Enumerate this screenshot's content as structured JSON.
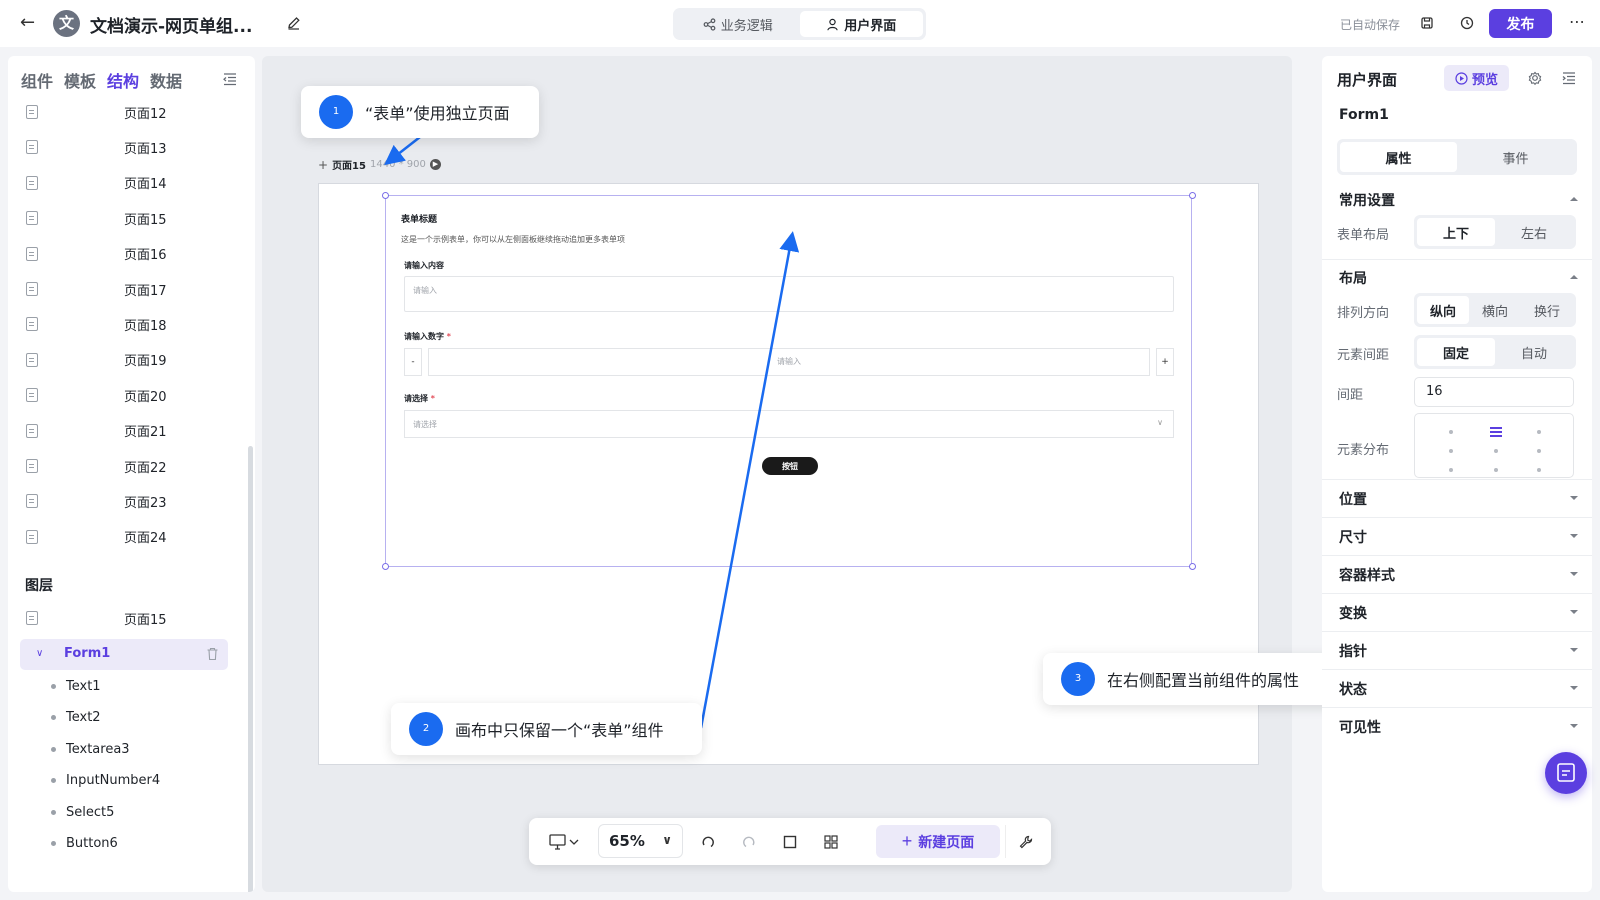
{
  "header": {
    "app_avatar": "文",
    "title": "文档演示-网页单组...",
    "tabs": [
      {
        "label": "业务逻辑",
        "icon": "share-icon"
      },
      {
        "label": "用户界面",
        "icon": "user-icon"
      }
    ],
    "autosave": "已自动保存",
    "publish_label": "发布"
  },
  "sidebar": {
    "tabs": [
      "组件",
      "模板",
      "结构",
      "数据"
    ],
    "active_tab": "结构",
    "pages": [
      "页面12",
      "页面13",
      "页面14",
      "页面15",
      "页面16",
      "页面17",
      "页面18",
      "页面19",
      "页面20",
      "页面21",
      "页面22",
      "页面23",
      "页面24"
    ],
    "layers_title": "图层",
    "layer_page": "页面15",
    "layer_form": "Form1",
    "layer_children": [
      "Text1",
      "Text2",
      "Textarea3",
      "InputNumber4",
      "Select5",
      "Button6"
    ]
  },
  "canvas": {
    "frame_name": "页面15",
    "frame_size": "1440 * 900",
    "form": {
      "title": "表单标题",
      "description": "这是一个示例表单，你可以从左侧面板继续拖动追加更多表单项",
      "field1_label": "请输入内容",
      "field1_placeholder": "请输入",
      "field2_label": "请输入数字",
      "field2_placeholder": "请输入",
      "minus": "-",
      "plus": "+",
      "field3_label": "请选择",
      "field3_placeholder": "请选择",
      "required_mark": "*",
      "button_label": "按钮"
    }
  },
  "callouts": [
    {
      "num": "1",
      "text": "“表单”使用独立页面"
    },
    {
      "num": "2",
      "text": "画布中只保留一个“表单”组件"
    },
    {
      "num": "3",
      "text": "在右侧配置当前组件的属性"
    }
  ],
  "bottom_toolbar": {
    "zoom": "65%",
    "new_page_label": "新建页面"
  },
  "right_panel": {
    "title": "用户界面",
    "preview_label": "预览",
    "component_name": "Form1",
    "tabs": [
      "属性",
      "事件"
    ],
    "active_tab": "属性",
    "common_settings": "常用设置",
    "form_layout_label": "表单布局",
    "form_layout_options": [
      "上下",
      "左右"
    ],
    "form_layout_selected": "上下",
    "layout_section": "布局",
    "direction_label": "排列方向",
    "direction_options": [
      "纵向",
      "横向",
      "换行"
    ],
    "direction_selected": "纵向",
    "spacing_label": "元素间距",
    "spacing_options": [
      "固定",
      "自动"
    ],
    "spacing_selected": "固定",
    "gap_label": "间距",
    "gap_value": "16",
    "distribution_label": "元素分布",
    "sections": [
      "位置",
      "尺寸",
      "容器样式",
      "变换",
      "指针",
      "状态",
      "可见性"
    ]
  },
  "colors": {
    "accent": "#5b3fe0",
    "callout_blue": "#1a6bf0",
    "panel_bg": "#ffffff",
    "canvas_bg": "#e9ebef"
  }
}
